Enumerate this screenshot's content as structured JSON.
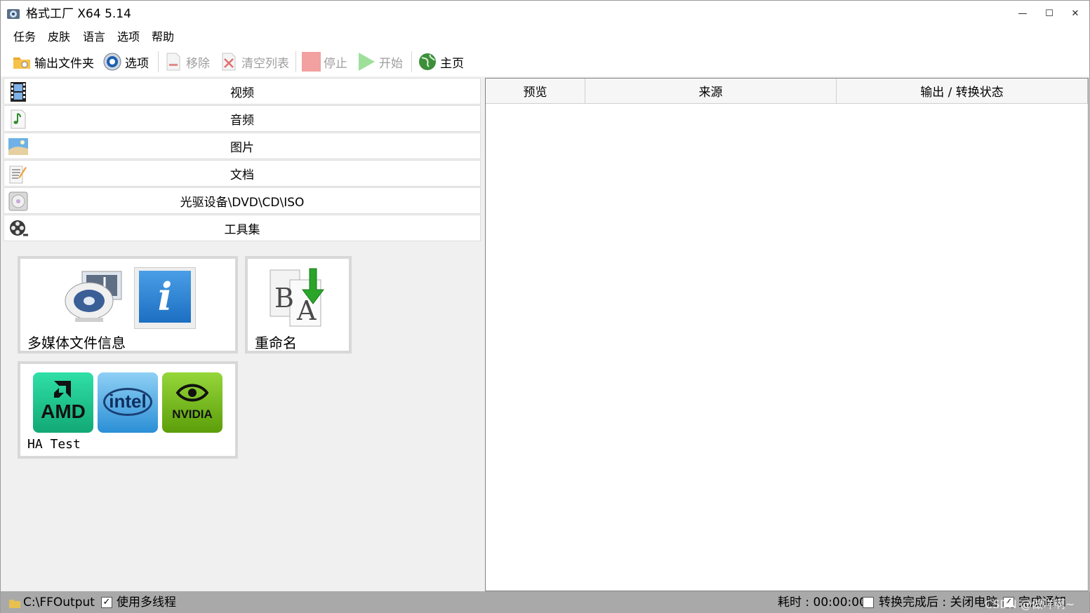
{
  "window": {
    "title": "格式工厂 X64 5.14"
  },
  "menu": [
    "任务",
    "皮肤",
    "语言",
    "选项",
    "帮助"
  ],
  "toolbar": {
    "output_folder": "输出文件夹",
    "options": "选项",
    "remove": "移除",
    "clear_list": "清空列表",
    "stop": "停止",
    "start": "开始",
    "home": "主页"
  },
  "categories": [
    "视频",
    "音频",
    "图片",
    "文档",
    "光驱设备\\DVD\\CD\\ISO",
    "工具集"
  ],
  "tools": {
    "media_info": "多媒体文件信息",
    "rename": "重命名",
    "ha_test": "HA Test",
    "brand_amd": "AMD",
    "brand_intel": "intel",
    "brand_nvidia": "NVIDIA",
    "rename_letters": [
      "B",
      "A"
    ]
  },
  "table": {
    "columns": [
      "预览",
      "来源",
      "输出 / 转换状态"
    ]
  },
  "status": {
    "output_path": "C:\\FFOutput",
    "multithread_label": "使用多线程",
    "multithread_checked": true,
    "elapsed": "耗时 : 00:00:00",
    "after_convert_label": "转换完成后 : 关闭电脑",
    "after_convert_checked": false,
    "notify_label": "完成通知",
    "notify_checked": true,
    "watermark": "CSDN @做咩啊~"
  },
  "colors": {
    "status_bg": "#a9a9a9",
    "amd_green": "#1ec58e",
    "intel_blue": "#2b8fd6",
    "nvidia_green": "#76b900"
  }
}
